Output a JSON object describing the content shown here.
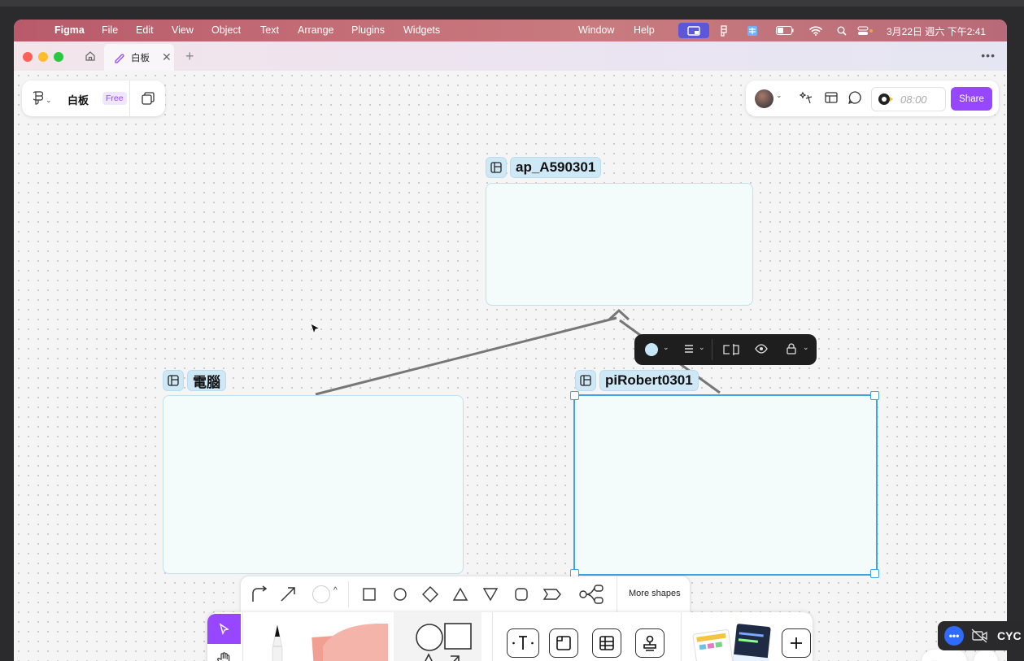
{
  "menubar": {
    "app_name": "Figma",
    "items": [
      "File",
      "Edit",
      "View",
      "Object",
      "Text",
      "Arrange",
      "Plugins",
      "Widgets"
    ],
    "right_items": [
      "Window",
      "Help"
    ],
    "clock": "3月22日 週六 下午2:41"
  },
  "tabs": {
    "active_label": "白板"
  },
  "file_panel": {
    "name": "白板",
    "plan_badge": "Free"
  },
  "top_right": {
    "timer": "08:00",
    "share_label": "Share"
  },
  "sections": [
    {
      "name": "ap_A590301"
    },
    {
      "name": "電腦"
    },
    {
      "name": "piRobert0301"
    }
  ],
  "shapes_bar": {
    "more_shapes_label": "More shapes"
  },
  "overlay": {
    "label": "CYC"
  },
  "colors": {
    "brand_purple": "#9747ff",
    "selection_blue": "#3ba6e0",
    "section_fill": "#f3fbfb"
  }
}
